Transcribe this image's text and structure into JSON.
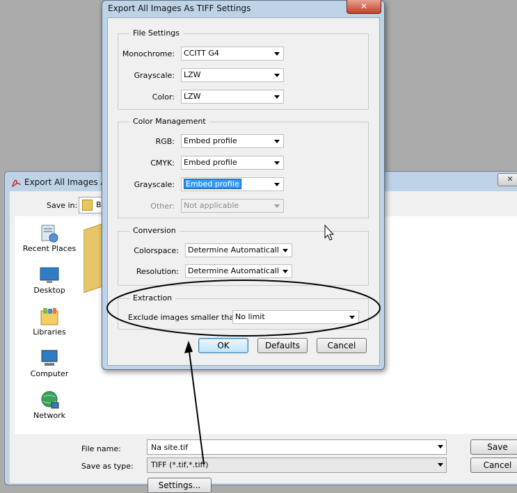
{
  "save_dialog": {
    "title": "Export All Images As",
    "close_glyph": "✕",
    "save_in_label": "Save in:",
    "save_in_value": "B",
    "places": [
      {
        "label": "Recent Places",
        "icon": "recent-places-icon"
      },
      {
        "label": "Desktop",
        "icon": "desktop-icon"
      },
      {
        "label": "Libraries",
        "icon": "libraries-icon"
      },
      {
        "label": "Computer",
        "icon": "computer-icon"
      },
      {
        "label": "Network",
        "icon": "network-icon"
      }
    ],
    "file_name_label": "File name:",
    "file_name_value": "Na site.tif",
    "save_as_type_label": "Save as type:",
    "save_as_type_value": "TIFF (*.tif,*.tiff)",
    "save_button": "Save",
    "cancel_button": "Cancel",
    "settings_button": "Settings..."
  },
  "tiff_dialog": {
    "title": "Export All Images As TIFF Settings",
    "close_glyph": "✕",
    "file_settings": {
      "title": "File Settings",
      "monochrome_label": "Monochrome:",
      "monochrome_value": "CCITT G4",
      "grayscale_label": "Grayscale:",
      "grayscale_value": "LZW",
      "color_label": "Color:",
      "color_value": "LZW"
    },
    "color_management": {
      "title": "Color Management",
      "rgb_label": "RGB:",
      "rgb_value": "Embed profile",
      "cmyk_label": "CMYK:",
      "cmyk_value": "Embed profile",
      "grayscale_label": "Grayscale:",
      "grayscale_value": "Embed profile",
      "other_label": "Other:",
      "other_value": "Not applicable"
    },
    "conversion": {
      "title": "Conversion",
      "colorspace_label": "Colorspace:",
      "colorspace_value": "Determine Automatically",
      "resolution_label": "Resolution:",
      "resolution_value": "Determine Automatically"
    },
    "extraction": {
      "title": "Extraction",
      "exclude_label": "Exclude images smaller than:",
      "exclude_value": "No limit"
    },
    "ok_button": "OK",
    "defaults_button": "Defaults",
    "cancel_button": "Cancel"
  },
  "colors": {
    "title_bar": "#bfd3e8",
    "close_button": "#c43f27",
    "selection": "#3399ff",
    "annotation": "#000000"
  }
}
